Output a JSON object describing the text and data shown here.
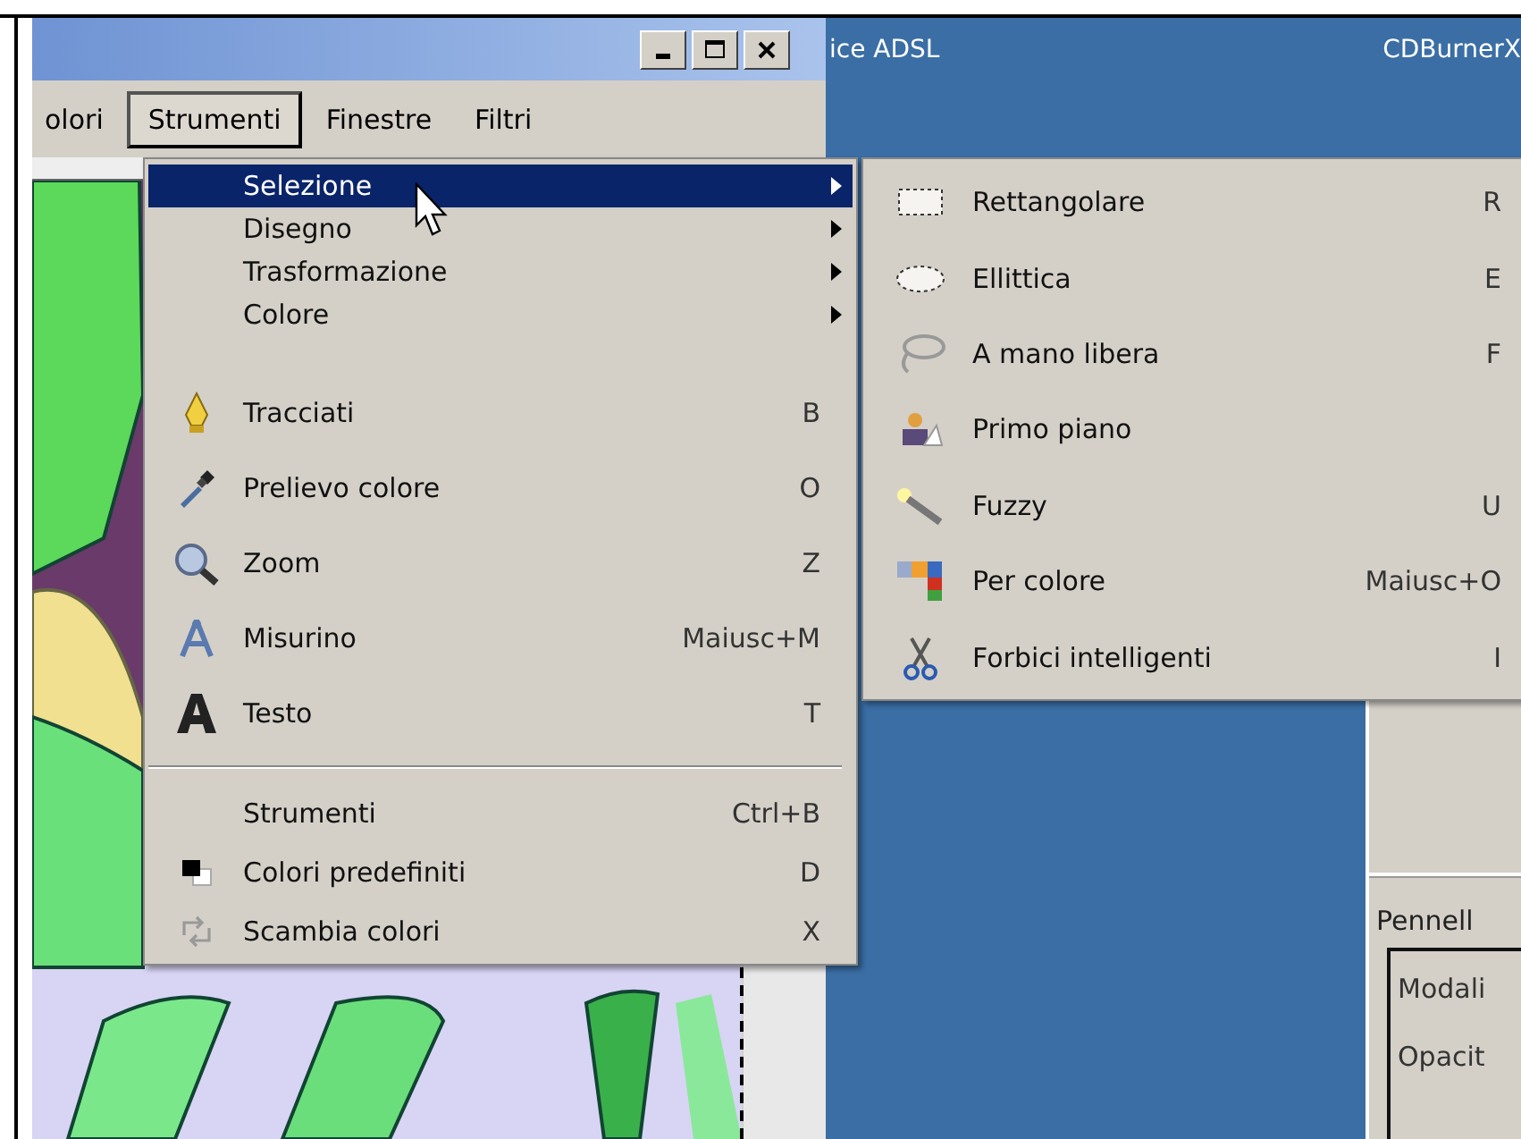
{
  "menu_bar": [
    {
      "label": "olori",
      "selected": false
    },
    {
      "label": "Strumenti",
      "selected": true
    },
    {
      "label": "Finestre",
      "selected": false
    },
    {
      "label": "Filtri",
      "selected": false
    }
  ],
  "desktop_icons": [
    "ice ADSL",
    "CDBurnerX"
  ],
  "menu": {
    "items": [
      {
        "kind": "submenu",
        "label": "Selezione",
        "selected": true
      },
      {
        "kind": "submenu",
        "label": "Disegno",
        "selected": false
      },
      {
        "kind": "submenu",
        "label": "Trasformazione",
        "selected": false
      },
      {
        "kind": "submenu",
        "label": "Colore",
        "selected": false
      },
      {
        "kind": "command",
        "label": "Tracciati",
        "shortcut": "B",
        "selected": false
      },
      {
        "kind": "command",
        "label": "Prelievo colore",
        "shortcut": "O",
        "selected": false
      },
      {
        "kind": "command",
        "label": "Zoom",
        "shortcut": "Z",
        "selected": false
      },
      {
        "kind": "command",
        "label": "Misurino",
        "shortcut": "Maiusc+M",
        "selected": false
      },
      {
        "kind": "command",
        "label": "Testo",
        "shortcut": "T",
        "selected": false
      },
      {
        "kind": "separator"
      },
      {
        "kind": "small",
        "label": "Strumenti",
        "shortcut": "Ctrl+B",
        "selected": false
      },
      {
        "kind": "small",
        "label": "Colori predefiniti",
        "shortcut": "D",
        "selected": false
      },
      {
        "kind": "small",
        "label": "Scambia colori",
        "shortcut": "X",
        "selected": false
      }
    ]
  },
  "submenu": {
    "items": [
      {
        "label": "Rettangolare",
        "shortcut": "R",
        "selected": false
      },
      {
        "label": "Ellittica",
        "shortcut": "E",
        "selected": false
      },
      {
        "label": "A mano libera",
        "shortcut": "F",
        "selected": false
      },
      {
        "label": "Primo piano",
        "selected": false
      },
      {
        "label": "Fuzzy",
        "shortcut": "U",
        "selected": false
      },
      {
        "label": "Per colore",
        "shortcut": "Maiusc+O",
        "selected": false
      },
      {
        "label": "Forbici intelligenti",
        "shortcut": "I",
        "selected": false
      }
    ]
  },
  "tool_options": {
    "title": "Pennell",
    "fields": [
      "Modali",
      "Opacit"
    ]
  }
}
